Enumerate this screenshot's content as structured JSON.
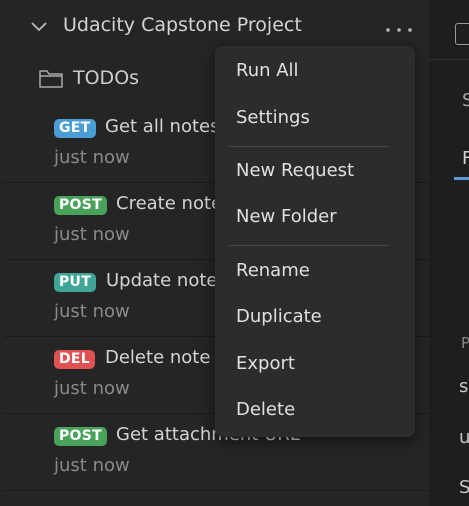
{
  "collection": {
    "title": "Udacity Capstone Project"
  },
  "folder": {
    "name": "TODOs"
  },
  "requests": [
    {
      "method": "GET",
      "method_color": "#4a9ed6",
      "name": "Get all notes",
      "time": "just now"
    },
    {
      "method": "POST",
      "method_color": "#49a25a",
      "name": "Create note",
      "time": "just now"
    },
    {
      "method": "PUT",
      "method_color": "#3fa596",
      "name": "Update note",
      "time": "just now"
    },
    {
      "method": "DEL",
      "method_color": "#e05252",
      "name": "Delete note",
      "time": "just now"
    },
    {
      "method": "POST",
      "method_color": "#49a25a",
      "name": "Get attachment URL",
      "time": "just now"
    }
  ],
  "context_menu": {
    "items": [
      {
        "label": "Run All"
      },
      {
        "label": "Settings"
      },
      {
        "label": "New Request"
      },
      {
        "label": "New Folder"
      },
      {
        "label": "Rename"
      },
      {
        "label": "Duplicate"
      },
      {
        "label": "Export"
      },
      {
        "label": "Delete"
      }
    ]
  },
  "right_panel": {
    "texts": [
      "S",
      "F",
      "P",
      "s",
      "u",
      "S"
    ]
  },
  "icons": {
    "collapse": "chevron-down-icon",
    "more": "more-horizontal-icon",
    "folder": "folder-icon"
  }
}
